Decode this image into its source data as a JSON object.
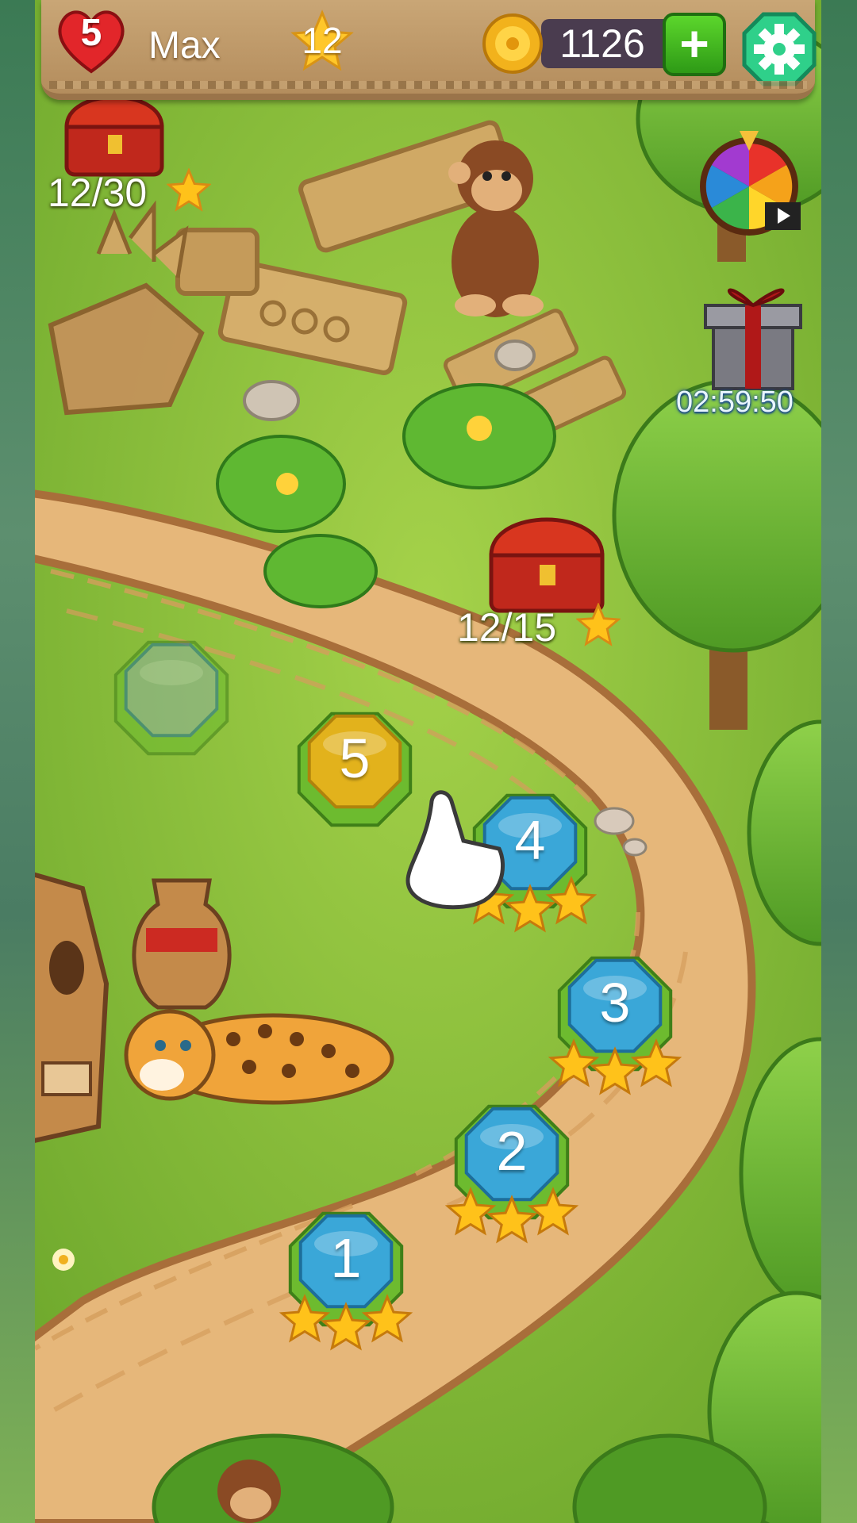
{
  "hud": {
    "lives": "5",
    "player_name": "Max",
    "star_level": "12",
    "coins": "1126",
    "add_coins_icon": "plus-icon",
    "settings_icon": "gear-icon"
  },
  "map": {
    "chests": [
      {
        "progress": "12/30"
      },
      {
        "progress": "12/15"
      }
    ],
    "bonus": {
      "spin_wheel_icon": "spin-wheel-icon",
      "gift_icon": "gift-box-icon",
      "gift_timer": "02:59:50"
    },
    "levels": [
      {
        "number": "1",
        "stars": 3,
        "state": "completed"
      },
      {
        "number": "2",
        "stars": 3,
        "state": "completed"
      },
      {
        "number": "3",
        "stars": 3,
        "state": "completed"
      },
      {
        "number": "4",
        "stars": 3,
        "state": "completed"
      },
      {
        "number": "5",
        "stars": 0,
        "state": "current"
      },
      {
        "number": "",
        "stars": 0,
        "state": "locked"
      }
    ]
  },
  "colors": {
    "completed_level": "#3aa7d8",
    "current_level": "#e2b21c",
    "locked_level": "#8fb0a0",
    "star": "#ffc21a",
    "grass": "#8cc63f",
    "path": "#e6b77a"
  }
}
